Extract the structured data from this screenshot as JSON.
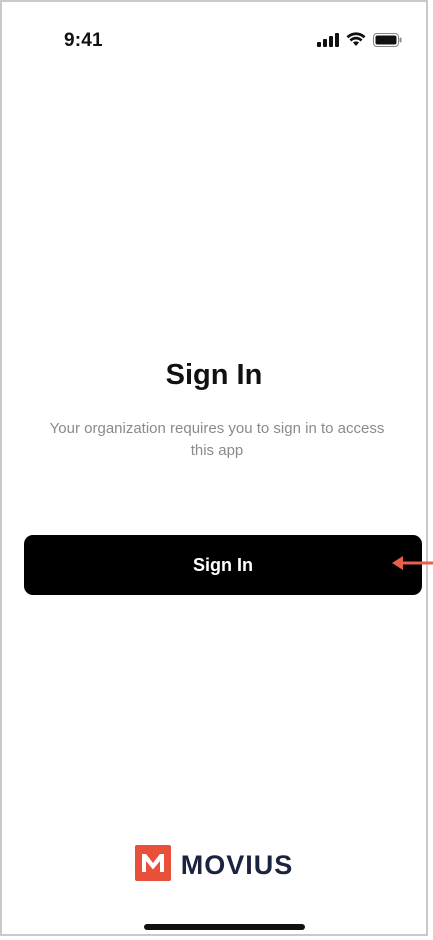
{
  "status_bar": {
    "time": "9:41",
    "icons": [
      "cellular-signal-icon",
      "wifi-icon",
      "battery-icon"
    ]
  },
  "screen": {
    "title": "Sign In",
    "subtitle": "Your organization requires you to sign in to access this app",
    "sign_in_button_label": "Sign In"
  },
  "annotation": {
    "arrow_icon": "left-arrow-icon",
    "arrow_color": "#e8604c"
  },
  "brand": {
    "logo_icon": "movius-logo-icon",
    "name": "MOVIUS",
    "logo_color": "#e8503a",
    "text_color": "#1c2340"
  },
  "colors": {
    "button_background": "#000000",
    "button_text": "#ffffff",
    "subtitle_text": "#8a8a8a"
  }
}
